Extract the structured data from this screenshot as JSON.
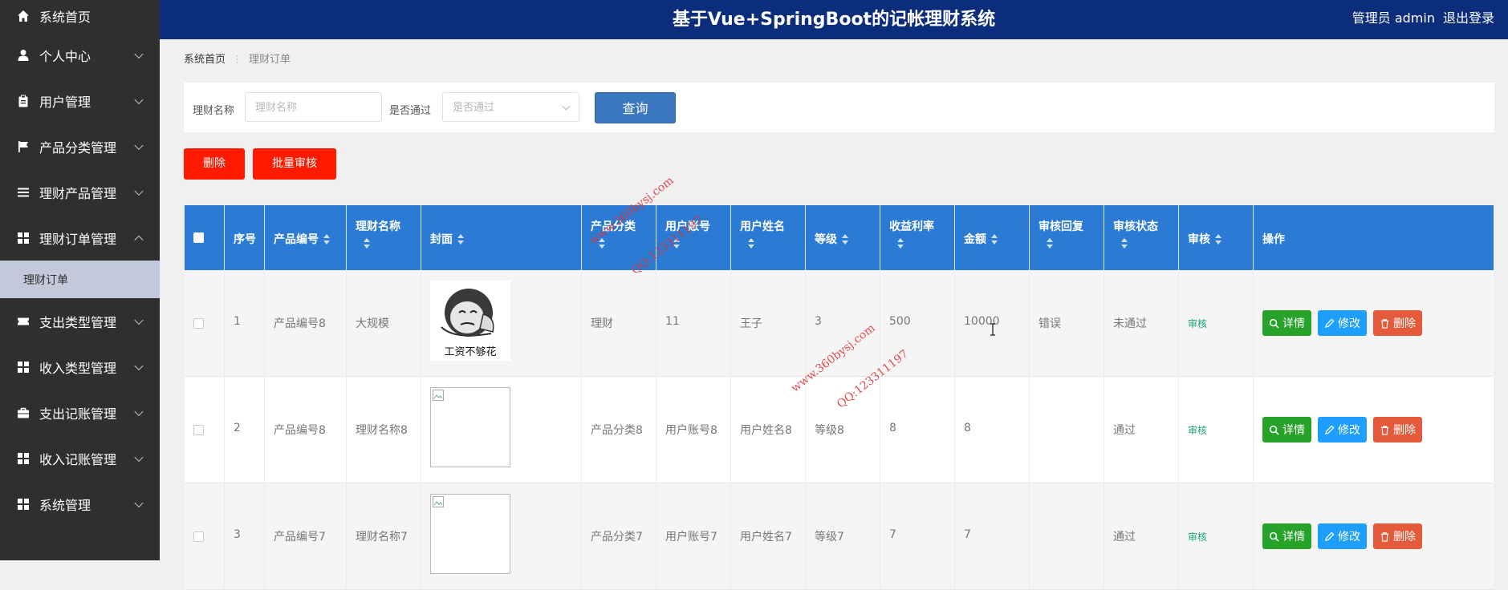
{
  "header": {
    "title": "基于Vue+SpringBoot的记帐理财系统",
    "role": "管理员 admin",
    "logout": "退出登录"
  },
  "sidebar": {
    "home": "系统首页",
    "items": [
      {
        "label": "个人中心"
      },
      {
        "label": "用户管理"
      },
      {
        "label": "产品分类管理"
      },
      {
        "label": "理财产品管理"
      },
      {
        "label": "理财订单管理"
      },
      {
        "label": "支出类型管理"
      },
      {
        "label": "收入类型管理"
      },
      {
        "label": "支出记账管理"
      },
      {
        "label": "收入记账管理"
      },
      {
        "label": "系统管理"
      }
    ],
    "active_sub": "理财订单"
  },
  "breadcrumb": {
    "home": "系统首页",
    "current": "理财订单"
  },
  "search": {
    "name_label": "理财名称",
    "name_placeholder": "理财名称",
    "pass_label": "是否通过",
    "pass_placeholder": "是否通过",
    "query": "查询"
  },
  "actions": {
    "delete": "删除",
    "batch_review": "批量审核"
  },
  "table": {
    "headers": {
      "index": "序号",
      "product_no": "产品编号",
      "name": "理财名称",
      "cover": "封面",
      "category": "产品分类",
      "account": "用户账号",
      "user_name": "用户姓名",
      "level": "等级",
      "rate": "收益利率",
      "amount": "金额",
      "reply": "审核回复",
      "status": "审核状态",
      "review": "审核",
      "ops": "操作"
    },
    "rows": [
      {
        "index": "1",
        "product_no": "产品编号8",
        "name": "大规模",
        "cover_caption": "工资不够花",
        "category": "理财",
        "account": "11",
        "user_name": "王子",
        "level": "3",
        "rate": "500",
        "amount": "10000",
        "reply": "错误",
        "status": "未通过",
        "review": "审核"
      },
      {
        "index": "2",
        "product_no": "产品编号8",
        "name": "理财名称8",
        "cover_caption": "",
        "category": "产品分类8",
        "account": "用户账号8",
        "user_name": "用户姓名8",
        "level": "等级8",
        "rate": "8",
        "amount": "8",
        "reply": "",
        "status": "通过",
        "review": "审核"
      },
      {
        "index": "3",
        "product_no": "产品编号7",
        "name": "理财名称7",
        "cover_caption": "",
        "category": "产品分类7",
        "account": "用户账号7",
        "user_name": "用户姓名7",
        "level": "等级7",
        "rate": "7",
        "amount": "7",
        "reply": "",
        "status": "通过",
        "review": "审核"
      }
    ],
    "op_labels": {
      "detail": "详情",
      "edit": "修改",
      "delete": "删除"
    }
  },
  "watermark": {
    "site": "www.360bysj.com",
    "qq": "QQ:123311197"
  },
  "colors": {
    "header": "#0b2d7c",
    "sidebar": "#2f2f2f",
    "table_head": "#2b7bd4",
    "danger": "#ff1a00",
    "query": "#3b78c0"
  }
}
